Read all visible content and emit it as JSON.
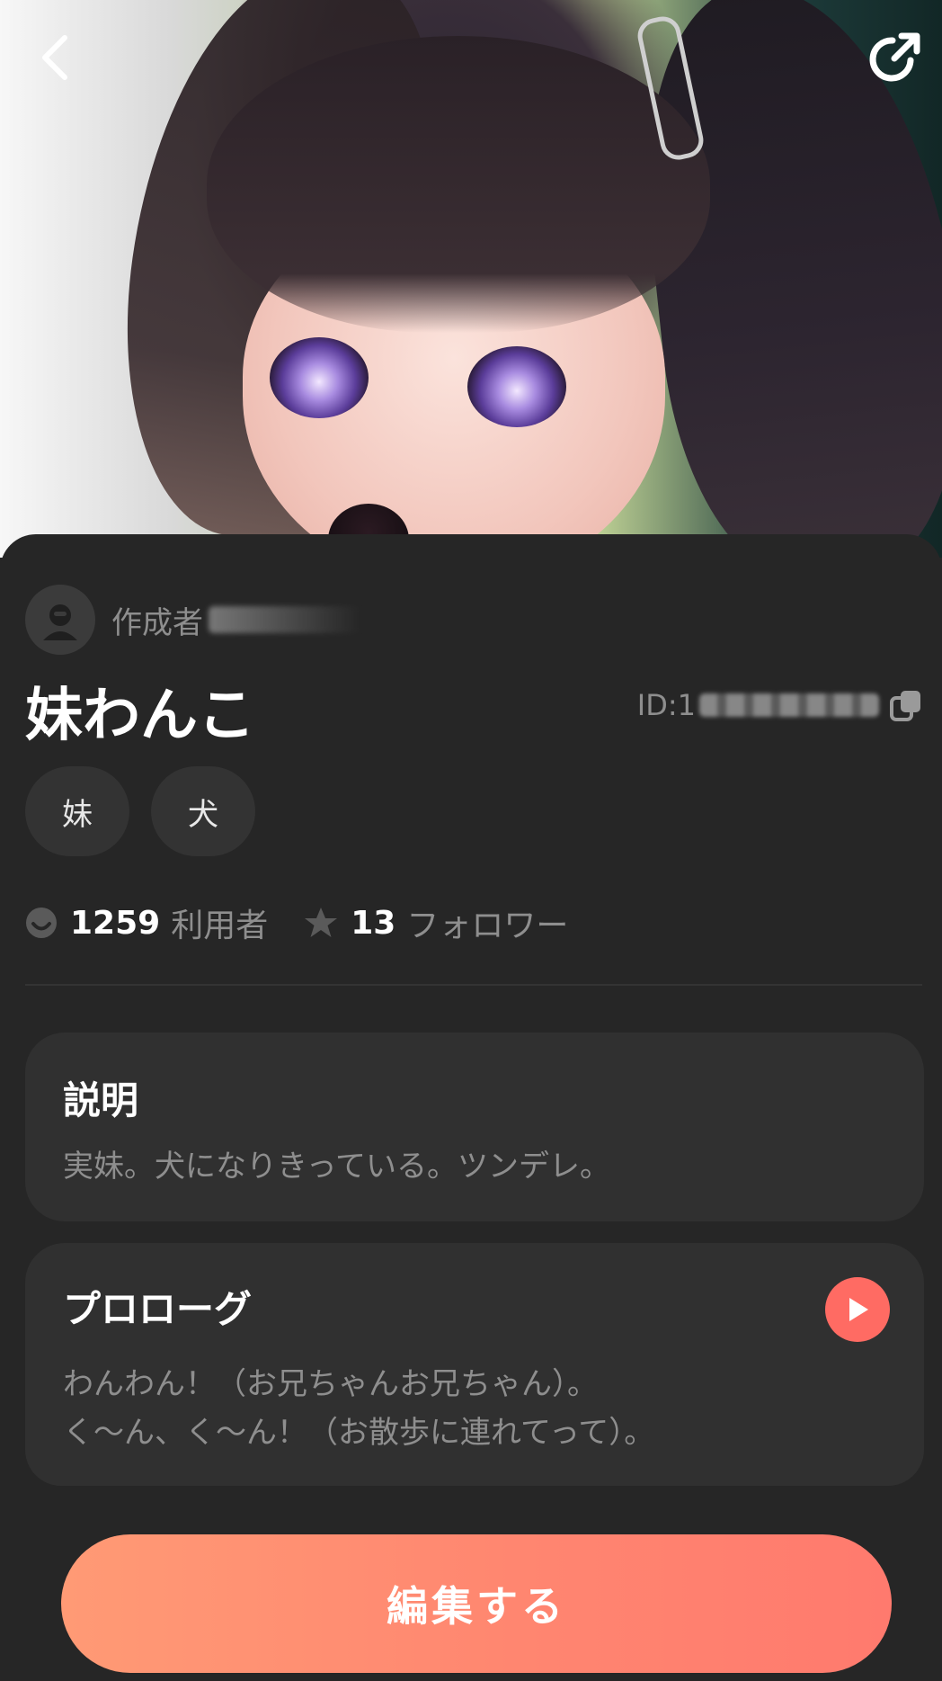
{
  "creator": {
    "label": "作成者"
  },
  "character": {
    "name": "妹わんこ",
    "id_label": "ID:1"
  },
  "tags": [
    "妹",
    "犬"
  ],
  "stats": {
    "users_count": "1259",
    "users_label": "利用者",
    "followers_count": "13",
    "followers_label": "フォロワー"
  },
  "description": {
    "title": "説明",
    "text": "実妹。犬になりきっている。ツンデレ。"
  },
  "prologue": {
    "title": "プロローグ",
    "line1": "わんわん！（お兄ちゃんお兄ちゃん）。",
    "line2": "く〜ん、く〜ん！（お散歩に連れてって）。"
  },
  "actions": {
    "edit_label": "編集する"
  },
  "colors": {
    "accent": "#ff7a6e",
    "background": "#262626",
    "card": "#303030"
  },
  "icons": [
    "back-icon",
    "share-icon",
    "avatar-icon",
    "copy-icon",
    "users-icon",
    "star-icon",
    "play-icon"
  ]
}
